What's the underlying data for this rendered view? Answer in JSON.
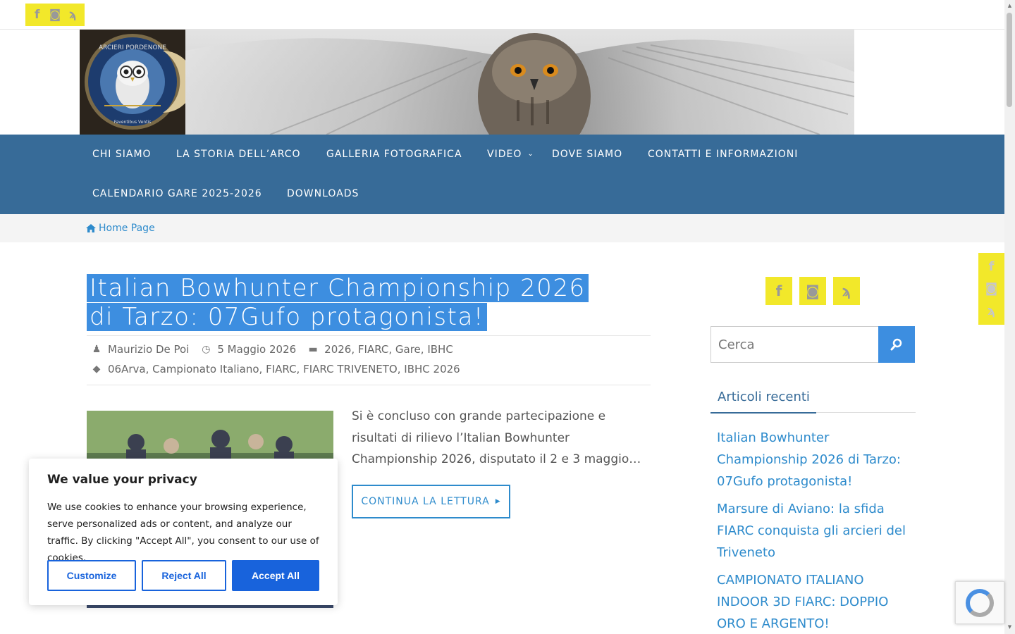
{
  "topbar": {
    "social": [
      "facebook-icon",
      "instagram-icon",
      "rss-icon"
    ]
  },
  "header": {
    "logo_text": "ARCIERI PORDENONE",
    "logo_motto": "Faventibus Ventis"
  },
  "nav": {
    "items": [
      "CHI SIAMO",
      "LA STORIA DELL’ARCO",
      "GALLERIA FOTOGRAFICA",
      "VIDEO",
      "DOVE SIAMO",
      "CONTATTI E INFORMAZIONI",
      "CALENDARIO GARE 2025-2026",
      "DOWNLOADS"
    ]
  },
  "breadcrumb": {
    "home": "Home Page"
  },
  "post": {
    "title": "Italian Bowhunter Championship 2026 di Tarzo: 07Gufo protagonista!",
    "author": "Maurizio De Poi",
    "date": "5 Maggio 2026",
    "categories": [
      "2026",
      "FIARC",
      "Gare",
      "IBHC"
    ],
    "tags": [
      "06Arva",
      "Campionato Italiano",
      "FIARC",
      "FIARC TRIVENETO",
      "IBHC 2026"
    ],
    "excerpt": "Si è concluso con grande partecipazione e risultati di rilievo l’Italian Bowhunter Championship 2026, disputato il 2 e 3 maggio…",
    "read_more": "CONTINUA LA LETTURA"
  },
  "sidebar": {
    "search_placeholder": "Cerca",
    "recent_title": "Articoli recenti",
    "recent": [
      "Italian Bowhunter Championship 2026 di Tarzo: 07Gufo protagonista!",
      "Marsure di Aviano: la sfida FIARC conquista gli arcieri del Triveneto",
      "CAMPIONATO ITALIANO INDOOR 3D FIARC: DOPPIO ORO E ARGENTO!"
    ]
  },
  "cookie": {
    "title": "We value your privacy",
    "text": "We use cookies to enhance your browsing experience, serve personalized ads or content, and analyze our traffic. By clicking \"Accept All\", you consent to our use of cookies.",
    "customize": "Customize",
    "reject": "Reject All",
    "accept": "Accept All"
  },
  "colors": {
    "nav": "#376b98",
    "accent": "#2e8bcc",
    "social": "#f2e82a",
    "cookie_btn": "#1863dc"
  }
}
